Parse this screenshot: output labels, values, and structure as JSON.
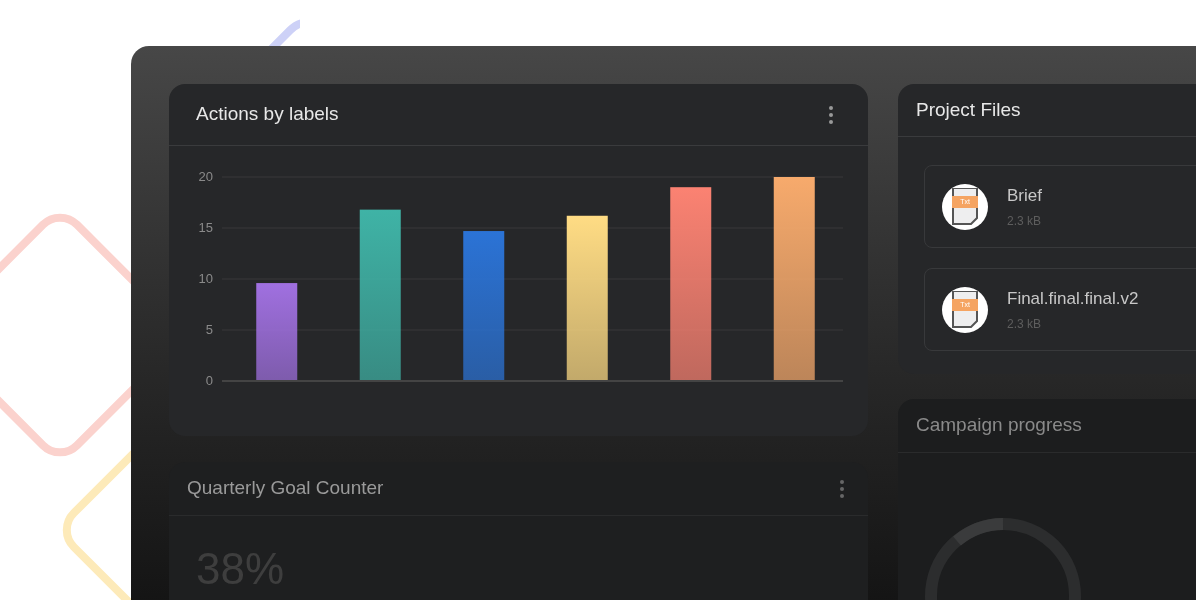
{
  "actions_card": {
    "title": "Actions by labels",
    "chart_data": {
      "type": "bar",
      "ylim": [
        0,
        20
      ],
      "yticks": [
        0,
        5,
        10,
        15,
        20
      ],
      "grid": true,
      "values": [
        9.6,
        16.8,
        14.7,
        16.2,
        19,
        20
      ],
      "colors": [
        "#a070e0",
        "#3fb3a6",
        "#2b73d6",
        "#ffdc84",
        "#fb8272",
        "#f7aa6c"
      ]
    }
  },
  "files_card": {
    "title": "Project Files",
    "files": [
      {
        "name": "Brief",
        "size": "2.3 kB",
        "badge": "Txt"
      },
      {
        "name": "Final.final.final.v2",
        "size": "2.3 kB",
        "badge": "Txt"
      }
    ]
  },
  "goal_card": {
    "title": "Quarterly Goal Counter",
    "value": "38%"
  },
  "campaign_card": {
    "title": "Campaign progress"
  }
}
